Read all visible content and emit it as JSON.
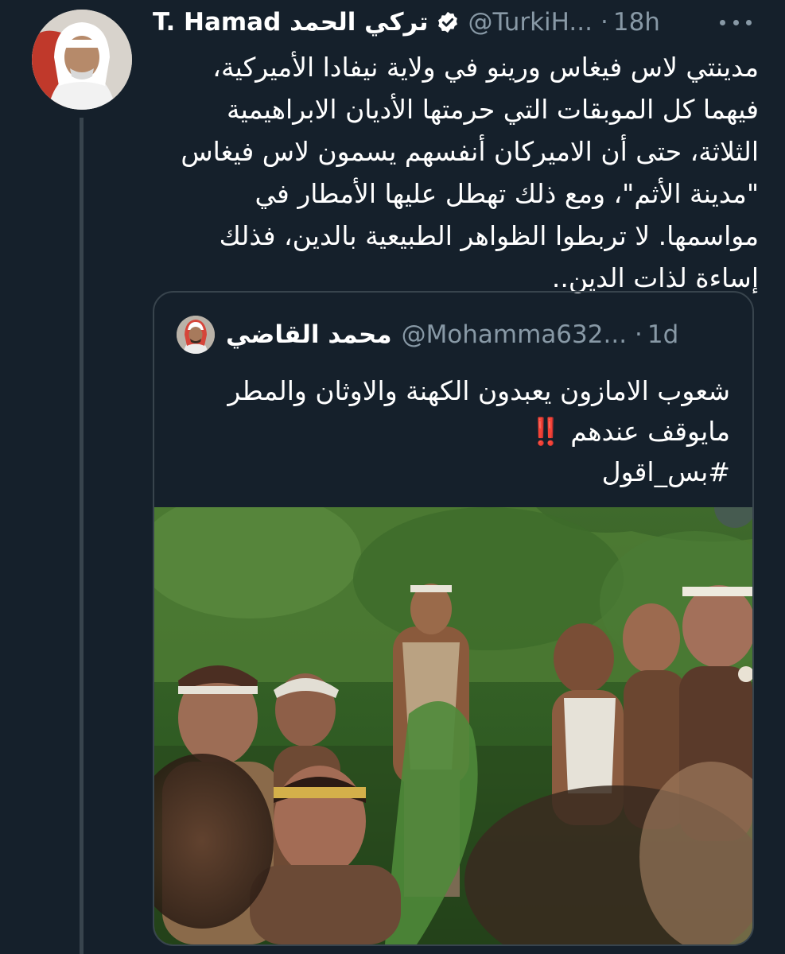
{
  "tweet": {
    "display_name": "T. Hamad تركي الحمد",
    "handle": "@TurkiH...",
    "separator": "·",
    "time": "18h",
    "text": "مدينتي لاس فيغاس ورينو في ولاية نيفادا الأميركية، فيهما كل الموبقات التي حرمتها الأديان الابراهيمية الثلاثة، حتى أن الاميركان أنفسهم يسمون لاس فيغاس \"مدينة الأثم\"، ومع ذلك تهطل عليها الأمطار في مواسمها. لا تربطوا الظواهر الطبيعية بالدين، فذلك إساءة لذات الدين..",
    "verified_icon": "verified-badge-icon",
    "more_icon": "more-horizontal-icon"
  },
  "quoted": {
    "display_name": "محمد القاضي",
    "handle": "@Mohamma632...",
    "separator": "·",
    "time": "1d",
    "text_line1": "شعوب الامازون يعبدون الكهنة والاوثان والمطر",
    "text_line2": "مايوقف عندهم",
    "exclamation": "‼️",
    "hashtag": "#بس_اقول",
    "media_icon": "photo-people-in-forest"
  },
  "colors": {
    "background": "#15202b",
    "border": "#38444d",
    "secondary_text": "#8899a6",
    "primary_text": "#ffffff",
    "exclamation": "#e0245e"
  }
}
